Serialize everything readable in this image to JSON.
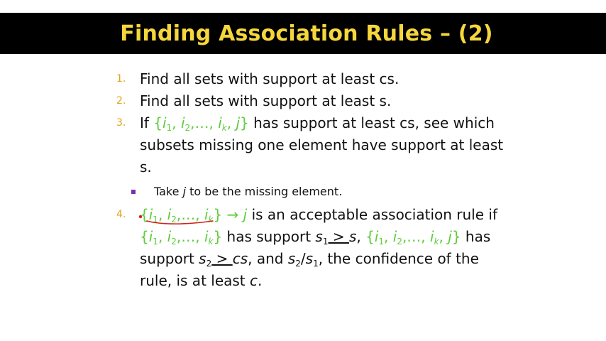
{
  "slide": {
    "title": "Finding Association Rules – (2)"
  },
  "items": {
    "1": {
      "number": "1.",
      "text": "Find all sets with support at least cs."
    },
    "2": {
      "number": "2.",
      "text": "Find all sets with support at least s."
    },
    "3": {
      "number": "3.",
      "text_a": "If ",
      "text_b": " has support at least cs, see which subsets missing one element have support at least s."
    },
    "4": {
      "number": "4.",
      "arrow": " → ",
      "t1": " is an acceptable association rule if ",
      "t2": " has support ",
      "t3": ", ",
      "t4": " has support ",
      "t5": ", and ",
      "t6": ", the confidence of the rule, is at least ",
      "t7": "."
    }
  },
  "sub_bullet": {
    "prefix": "Take ",
    "var": "j",
    "suffix": " to be the missing element."
  },
  "math": {
    "set_full_open": "{",
    "i": "i",
    "sub1": "1",
    "sub2": "2",
    "subk": "k",
    "comma": ", ",
    "ellipsis": ",…, ",
    "j": "j",
    "close": "}",
    "s": "s",
    "geq": " > ",
    "c": "c",
    "cs": "cs",
    "slash": "/"
  },
  "colors": {
    "title": "#f5d63c",
    "title_bar": "#000000",
    "math_green": "#5fcc3c",
    "number_orange": "#e2a21a",
    "bullet_purple": "#7a2fb0",
    "ink_red": "#d0201a"
  }
}
